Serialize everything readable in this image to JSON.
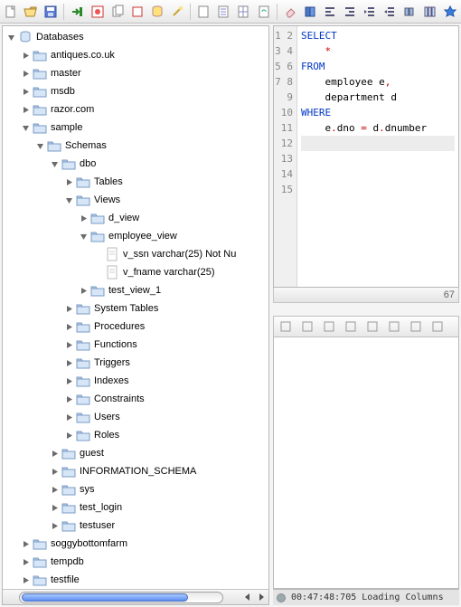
{
  "toolbar1": [
    {
      "name": "new-file-icon",
      "glyph": "newfile"
    },
    {
      "name": "open-folder-icon",
      "glyph": "openfolder"
    },
    {
      "name": "save-icon",
      "glyph": "save"
    },
    {
      "name": "sep"
    },
    {
      "name": "import-icon",
      "glyph": "arrowin"
    },
    {
      "name": "refresh-red-icon",
      "glyph": "refreshred"
    },
    {
      "name": "copy-icon",
      "glyph": "copy"
    },
    {
      "name": "stop-icon",
      "glyph": "stop"
    },
    {
      "name": "cylinder-icon",
      "glyph": "db"
    },
    {
      "name": "wand-icon",
      "glyph": "wand"
    },
    {
      "name": "sep"
    },
    {
      "name": "doc1-icon",
      "glyph": "doc"
    },
    {
      "name": "doc-lines-icon",
      "glyph": "doclines"
    },
    {
      "name": "doc-grid-icon",
      "glyph": "docgrid"
    },
    {
      "name": "doc-refresh-icon",
      "glyph": "docref"
    },
    {
      "name": "sep"
    },
    {
      "name": "eraser-icon",
      "glyph": "eraser"
    },
    {
      "name": "book-icon",
      "glyph": "book"
    },
    {
      "name": "align-left-icon",
      "glyph": "al"
    },
    {
      "name": "align-right-icon",
      "glyph": "ar"
    },
    {
      "name": "indent-icon",
      "glyph": "ind"
    },
    {
      "name": "outdent-icon",
      "glyph": "outd"
    },
    {
      "name": "group-icon",
      "glyph": "grp"
    },
    {
      "name": "columns-icon",
      "glyph": "cols"
    },
    {
      "name": "star-icon",
      "glyph": "star"
    }
  ],
  "tree": {
    "root": {
      "label": "Databases",
      "icon": "db",
      "expanded": true
    },
    "nodes": [
      {
        "d": 1,
        "icon": "folder",
        "label": "antiques.co.uk",
        "exp": "closed"
      },
      {
        "d": 1,
        "icon": "folder",
        "label": "master",
        "exp": "closed"
      },
      {
        "d": 1,
        "icon": "folder",
        "label": "msdb",
        "exp": "closed"
      },
      {
        "d": 1,
        "icon": "folder",
        "label": "razor.com",
        "exp": "closed"
      },
      {
        "d": 1,
        "icon": "folder",
        "label": "sample",
        "exp": "open"
      },
      {
        "d": 2,
        "icon": "folder",
        "label": "Schemas",
        "exp": "open"
      },
      {
        "d": 3,
        "icon": "folder",
        "label": "dbo",
        "exp": "open"
      },
      {
        "d": 4,
        "icon": "folder",
        "label": "Tables",
        "exp": "closed"
      },
      {
        "d": 4,
        "icon": "folder",
        "label": "Views",
        "exp": "open"
      },
      {
        "d": 5,
        "icon": "folder",
        "label": "d_view",
        "exp": "closed"
      },
      {
        "d": 5,
        "icon": "folder",
        "label": "employee_view",
        "exp": "open"
      },
      {
        "d": 6,
        "icon": "column",
        "label": "v_ssn varchar(25) Not Nu",
        "exp": "none"
      },
      {
        "d": 6,
        "icon": "column",
        "label": "v_fname varchar(25)",
        "exp": "none"
      },
      {
        "d": 5,
        "icon": "folder",
        "label": "test_view_1",
        "exp": "closed"
      },
      {
        "d": 4,
        "icon": "folder",
        "label": "System Tables",
        "exp": "closed"
      },
      {
        "d": 4,
        "icon": "folder",
        "label": "Procedures",
        "exp": "closed"
      },
      {
        "d": 4,
        "icon": "folder",
        "label": "Functions",
        "exp": "closed"
      },
      {
        "d": 4,
        "icon": "folder",
        "label": "Triggers",
        "exp": "closed"
      },
      {
        "d": 4,
        "icon": "folder",
        "label": "Indexes",
        "exp": "closed"
      },
      {
        "d": 4,
        "icon": "folder",
        "label": "Constraints",
        "exp": "closed"
      },
      {
        "d": 4,
        "icon": "folder",
        "label": "Users",
        "exp": "closed"
      },
      {
        "d": 4,
        "icon": "folder",
        "label": "Roles",
        "exp": "closed"
      },
      {
        "d": 3,
        "icon": "folder",
        "label": "guest",
        "exp": "closed"
      },
      {
        "d": 3,
        "icon": "folder",
        "label": "INFORMATION_SCHEMA",
        "exp": "closed"
      },
      {
        "d": 3,
        "icon": "folder",
        "label": "sys",
        "exp": "closed"
      },
      {
        "d": 3,
        "icon": "folder",
        "label": "test_login",
        "exp": "closed"
      },
      {
        "d": 3,
        "icon": "folder",
        "label": "testuser",
        "exp": "closed"
      },
      {
        "d": 1,
        "icon": "folder",
        "label": "soggybottomfarm",
        "exp": "closed"
      },
      {
        "d": 1,
        "icon": "folder",
        "label": "tempdb",
        "exp": "closed"
      },
      {
        "d": 1,
        "icon": "folder",
        "label": "testfile",
        "exp": "closed"
      }
    ]
  },
  "sql": {
    "lines": 15,
    "tokens": [
      [
        {
          "t": "SELECT",
          "c": "kw"
        }
      ],
      [
        {
          "t": "    "
        },
        {
          "t": "*",
          "c": "op"
        }
      ],
      [
        {
          "t": "FROM",
          "c": "kw"
        }
      ],
      [
        {
          "t": "    employee e"
        },
        {
          "t": ",",
          "c": "op"
        }
      ],
      [
        {
          "t": "    department d"
        }
      ],
      [
        {
          "t": "WHERE",
          "c": "kw"
        }
      ],
      [
        {
          "t": "    e"
        },
        {
          "t": ".",
          "c": "op"
        },
        {
          "t": "dno "
        },
        {
          "t": "=",
          "c": "op"
        },
        {
          "t": " d"
        },
        {
          "t": ".",
          "c": "op"
        },
        {
          "t": "dnumber"
        }
      ]
    ],
    "current_line": 8,
    "scroll_pos": "67"
  },
  "results_toolbar": [
    {
      "name": "first-icon"
    },
    {
      "name": "prev-icon"
    },
    {
      "name": "next-icon"
    },
    {
      "name": "last-icon"
    },
    {
      "name": "insert-icon"
    },
    {
      "name": "delete-icon"
    },
    {
      "name": "grid-icon"
    },
    {
      "name": "export-icon"
    }
  ],
  "status": {
    "time": "00:47:48:705",
    "text": "Loading Columns"
  }
}
